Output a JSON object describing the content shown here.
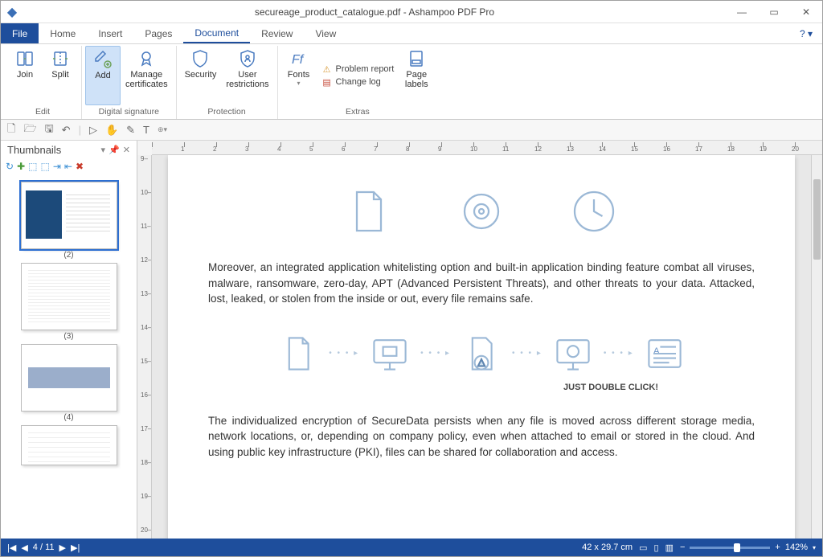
{
  "window": {
    "title": "secureage_product_catalogue.pdf - Ashampoo PDF Pro"
  },
  "tabs": {
    "file": "File",
    "home": "Home",
    "insert": "Insert",
    "pages": "Pages",
    "document": "Document",
    "review": "Review",
    "view": "View",
    "help": "?"
  },
  "ribbon": {
    "edit": {
      "label": "Edit",
      "join": "Join",
      "split": "Split"
    },
    "sig": {
      "label": "Digital signature",
      "add": "Add",
      "manage": "Manage\ncertificates"
    },
    "prot": {
      "label": "Protection",
      "security": "Security",
      "restrict": "User\nrestrictions"
    },
    "extras": {
      "label": "Extras",
      "fonts": "Fonts",
      "problem": "Problem report",
      "changelog": "Change log",
      "pagelabels": "Page\nlabels"
    }
  },
  "thumbs": {
    "title": "Thumbnails",
    "items": [
      {
        "label": "(2)"
      },
      {
        "label": "(3)"
      },
      {
        "label": "(4)"
      },
      {
        "label": ""
      }
    ]
  },
  "doc": {
    "para1": "Moreover, an integrated application whitelisting option and built-in application binding feature combat all viruses, malware, ransomware, zero-day, APT (Advanced Persistent Threats), and other threats to your data.  Attacked, lost, leaked, or stolen from the inside or out, every file remains safe.",
    "caption": "JUST DOUBLE CLICK!",
    "para2": "The individualized encryption of SecureData persists when any file is moved across different storage media, network locations, or, depending on company policy, even when attached to email or stored in the cloud. And using public key infrastructure (PKI), files can be shared for collaboration and access."
  },
  "status": {
    "page": "4 / 11",
    "dims": "42 x 29.7 cm",
    "zoom": "142%"
  }
}
